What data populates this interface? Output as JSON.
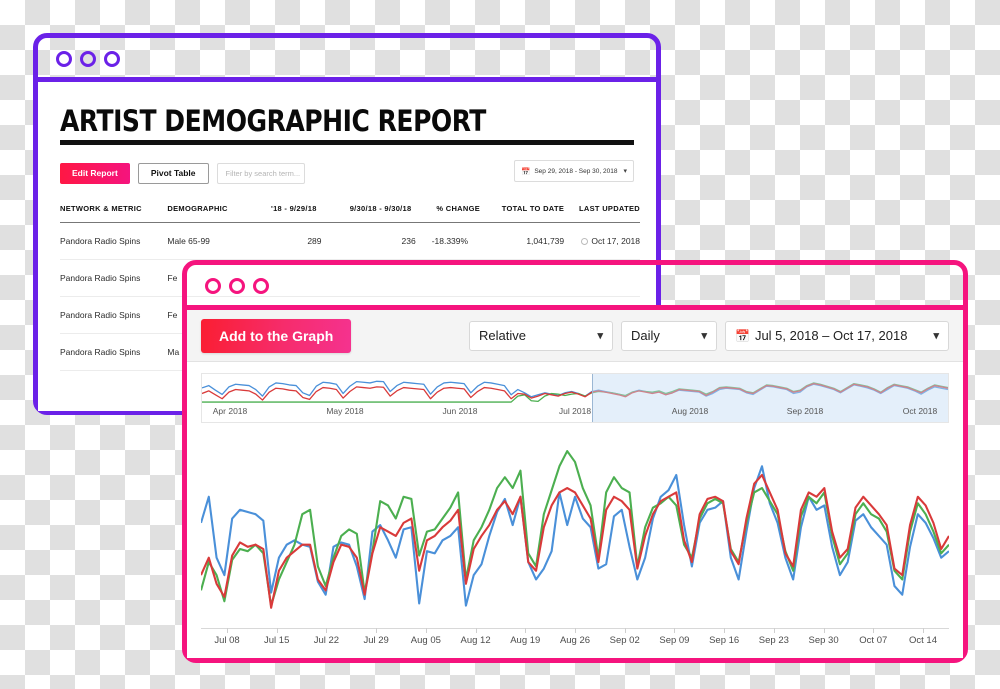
{
  "report_window": {
    "title": "ARTIST DEMOGRAPHIC REPORT",
    "dots": [
      "close-dot",
      "minimize-dot",
      "maximize-dot"
    ],
    "toolbar": {
      "edit_report_label": "Edit Report",
      "pivot_table_label": "Pivot Table",
      "search_placeholder": "Filter by search term...",
      "date_range_label": "Sep 29, 2018 - Sep 30, 2018",
      "calendar_icon": "calendar-icon",
      "chevron_icon": "chevron-down-icon"
    },
    "table": {
      "columns": [
        "NETWORK & METRIC",
        "DEMOGRAPHIC",
        "'18 - 9/29/18",
        "9/30/18 - 9/30/18",
        "% CHANGE",
        "TOTAL TO DATE",
        "LAST UPDATED"
      ],
      "rows": [
        {
          "network": "Pandora Radio Spins",
          "demographic": "Male 65-99",
          "previous": "289",
          "current": "236",
          "change": "-18.339%",
          "total": "1,041,739",
          "updated": "Oct 17, 2018"
        },
        {
          "network": "Pandora Radio Spins",
          "demographic": "Fe",
          "previous": "",
          "current": "",
          "change": "",
          "total": "",
          "updated": ""
        },
        {
          "network": "Pandora Radio Spins",
          "demographic": "Fe",
          "previous": "",
          "current": "",
          "change": "",
          "total": "",
          "updated": ""
        },
        {
          "network": "Pandora Radio Spins",
          "demographic": "Ma",
          "previous": "",
          "current": "",
          "change": "",
          "total": "",
          "updated": ""
        }
      ]
    }
  },
  "graph_window": {
    "dots": [
      "close-dot",
      "minimize-dot",
      "maximize-dot"
    ],
    "toolbar": {
      "add_to_graph_label": "Add to the Graph",
      "mode_select_value": "Relative",
      "interval_select_value": "Daily",
      "date_range_label": "Jul 5, 2018 – Oct 17, 2018",
      "calendar_icon": "calendar-icon",
      "chevron_icon": "chevron-down-icon"
    }
  },
  "colors": {
    "purple_border": "#6B21E8",
    "pink_border": "#F5147E",
    "accent_red": "#FA1E32",
    "accent_pink": "#F5328F",
    "series_blue": "#4A90D9",
    "series_green": "#4CAF50",
    "series_red": "#D93A3A",
    "brush_selection": "#C4DCF5"
  },
  "chart_data": {
    "type": "line",
    "title": "",
    "xlabel": "",
    "ylabel": "",
    "grid": false,
    "legend_position": "none",
    "x_tick_labels": [
      "Jul 08",
      "Jul 15",
      "Jul 22",
      "Jul 29",
      "Aug 05",
      "Aug 12",
      "Aug 19",
      "Aug 26",
      "Sep 02",
      "Sep 09",
      "Sep 16",
      "Sep 23",
      "Sep 30",
      "Oct 07",
      "Oct 14"
    ],
    "x_range": [
      "Jul 5, 2018",
      "Oct 17, 2018"
    ],
    "ylim": [
      0,
      100
    ],
    "series": [
      {
        "name": "series-blue",
        "color": "#4A90D9",
        "values": [
          46,
          58,
          30,
          22,
          48,
          52,
          51,
          50,
          47,
          14,
          30,
          36,
          38,
          36,
          35,
          19,
          13,
          35,
          37,
          36,
          26,
          11,
          42,
          45,
          38,
          30,
          43,
          44,
          9,
          33,
          32,
          38,
          40,
          44,
          8,
          22,
          27,
          40,
          51,
          57,
          45,
          58,
          28,
          20,
          25,
          33,
          60,
          45,
          58,
          48,
          44,
          25,
          27,
          49,
          52,
          35,
          20,
          30,
          48,
          58,
          61,
          68,
          45,
          26,
          46,
          52,
          53,
          56,
          30,
          20,
          42,
          62,
          72,
          55,
          46,
          30,
          20,
          44,
          58,
          52,
          54,
          35,
          22,
          28,
          47,
          50,
          44,
          40,
          36,
          17,
          13,
          35,
          50,
          46,
          39,
          30,
          33
        ]
      },
      {
        "name": "series-green",
        "color": "#4CAF50",
        "values": [
          15,
          28,
          22,
          10,
          29,
          34,
          33,
          36,
          32,
          8,
          20,
          28,
          36,
          50,
          52,
          26,
          17,
          30,
          40,
          43,
          41,
          14,
          33,
          56,
          54,
          48,
          58,
          57,
          31,
          42,
          43,
          48,
          53,
          60,
          20,
          38,
          44,
          52,
          62,
          67,
          62,
          70,
          32,
          26,
          50,
          61,
          72,
          79,
          74,
          62,
          54,
          30,
          60,
          67,
          62,
          60,
          26,
          44,
          53,
          55,
          58,
          54,
          36,
          30,
          48,
          55,
          57,
          55,
          34,
          28,
          46,
          60,
          62,
          56,
          50,
          33,
          24,
          49,
          58,
          55,
          60,
          40,
          27,
          32,
          50,
          55,
          50,
          48,
          42,
          24,
          20,
          42,
          55,
          50,
          42,
          32,
          36
        ]
      },
      {
        "name": "series-red",
        "color": "#D93A3A",
        "values": [
          22,
          30,
          18,
          12,
          31,
          37,
          35,
          36,
          34,
          7,
          24,
          30,
          33,
          36,
          36,
          20,
          15,
          28,
          36,
          35,
          30,
          13,
          32,
          44,
          42,
          40,
          46,
          48,
          24,
          38,
          40,
          44,
          47,
          52,
          18,
          34,
          40,
          45,
          52,
          56,
          50,
          58,
          28,
          24,
          44,
          54,
          60,
          62,
          60,
          54,
          48,
          28,
          52,
          58,
          56,
          52,
          25,
          40,
          50,
          56,
          58,
          60,
          38,
          28,
          50,
          57,
          58,
          56,
          33,
          27,
          48,
          64,
          68,
          60,
          52,
          32,
          26,
          52,
          60,
          58,
          62,
          42,
          30,
          34,
          53,
          58,
          54,
          50,
          45,
          25,
          22,
          45,
          58,
          54,
          46,
          34,
          40
        ]
      }
    ],
    "overview": {
      "x_tick_labels": [
        "Apr 2018",
        "May 2018",
        "Jun 2018",
        "Jul 2018",
        "Aug 2018",
        "Sep 2018",
        "Oct 2018"
      ],
      "selection_start_label": "Jul 2018",
      "selection_end_label": "Oct 2018",
      "series": [
        {
          "name": "overview-blue",
          "color": "#4A90D9",
          "values": [
            55,
            62,
            48,
            35,
            58,
            66,
            64,
            62,
            50,
            30,
            58,
            70,
            68,
            64,
            62,
            40,
            32,
            60,
            72,
            70,
            66,
            38,
            60,
            74,
            72,
            70,
            75,
            74,
            44,
            62,
            72,
            70,
            68,
            66,
            36,
            58,
            70,
            72,
            70,
            68,
            40,
            60,
            72,
            70,
            66,
            62,
            34,
            50,
            40,
            28,
            34,
            40,
            36,
            32,
            40,
            44,
            38,
            30,
            44,
            48,
            44,
            40,
            36,
            30,
            42,
            48,
            44,
            40,
            44,
            34,
            40,
            48,
            46,
            44,
            42,
            30,
            38,
            50,
            54,
            52,
            50,
            40,
            35,
            48,
            60,
            58,
            54,
            50,
            38,
            42,
            58,
            66,
            62,
            56,
            50,
            40,
            52,
            64,
            60,
            55,
            48,
            38,
            50,
            62,
            58,
            54,
            46,
            36,
            48,
            58,
            54,
            50
          ]
        },
        {
          "name": "overview-green",
          "color": "#4CAF50",
          "values": [
            12,
            12,
            12,
            12,
            12,
            12,
            12,
            12,
            12,
            12,
            12,
            12,
            12,
            12,
            12,
            12,
            12,
            12,
            12,
            12,
            12,
            12,
            12,
            12,
            12,
            12,
            12,
            12,
            12,
            12,
            12,
            12,
            12,
            12,
            12,
            12,
            12,
            12,
            12,
            12,
            12,
            12,
            12,
            12,
            12,
            12,
            12,
            30,
            34,
            16,
            14,
            30,
            38,
            36,
            32,
            36,
            38,
            30,
            40,
            44,
            42,
            40,
            36,
            32,
            42,
            46,
            44,
            42,
            46,
            38,
            44,
            52,
            50,
            48,
            46,
            36,
            44,
            56,
            58,
            56,
            54,
            44,
            40,
            52,
            64,
            62,
            58,
            54,
            44,
            48,
            62,
            70,
            66,
            60,
            54,
            44,
            56,
            68,
            64,
            60,
            52,
            42,
            56,
            66,
            62,
            58,
            50,
            42,
            54,
            64,
            60,
            56
          ]
        },
        {
          "name": "overview-red",
          "color": "#D93A3A",
          "values": [
            38,
            46,
            34,
            22,
            42,
            50,
            48,
            46,
            36,
            18,
            42,
            54,
            52,
            48,
            46,
            26,
            20,
            44,
            56,
            54,
            50,
            24,
            44,
            58,
            56,
            54,
            58,
            57,
            30,
            46,
            56,
            54,
            52,
            50,
            22,
            42,
            54,
            56,
            54,
            52,
            26,
            44,
            56,
            54,
            50,
            46,
            22,
            38,
            36,
            24,
            30,
            38,
            34,
            30,
            38,
            42,
            36,
            28,
            42,
            46,
            42,
            38,
            34,
            28,
            40,
            46,
            42,
            38,
            42,
            34,
            40,
            50,
            48,
            46,
            44,
            32,
            42,
            54,
            56,
            54,
            52,
            42,
            38,
            50,
            62,
            60,
            56,
            52,
            42,
            46,
            60,
            68,
            64,
            58,
            52,
            42,
            54,
            66,
            62,
            58,
            50,
            40,
            54,
            64,
            60,
            56,
            48,
            40,
            52,
            62,
            58,
            54
          ]
        }
      ]
    }
  }
}
